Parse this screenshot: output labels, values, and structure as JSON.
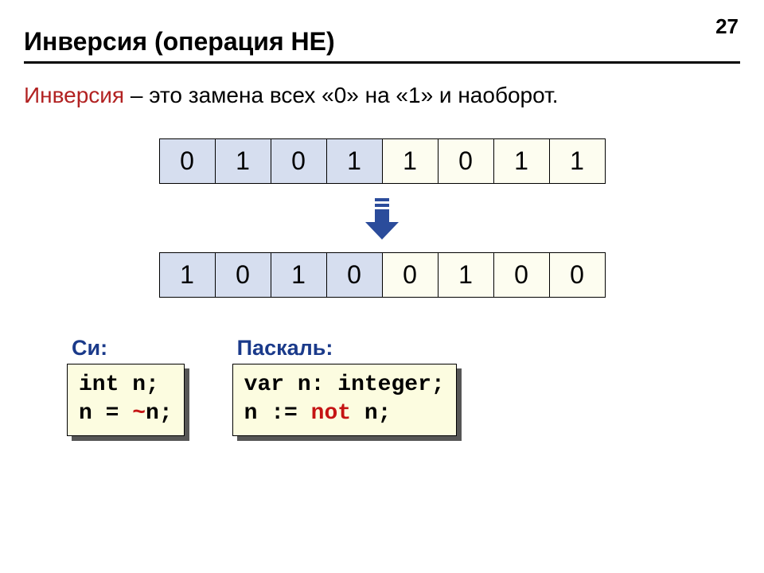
{
  "pageNumber": "27",
  "title": "Инверсия (операция НЕ)",
  "definition": {
    "term": "Инверсия",
    "rest": " – это замена всех «0» на «1» и наоборот."
  },
  "bitsTop": [
    "0",
    "1",
    "0",
    "1",
    "1",
    "0",
    "1",
    "1"
  ],
  "bitsBottom": [
    "1",
    "0",
    "1",
    "0",
    "0",
    "1",
    "0",
    "0"
  ],
  "colorClassesTop": [
    "blue",
    "blue",
    "blue",
    "blue",
    "yellow",
    "yellow",
    "yellow",
    "yellow"
  ],
  "colorClassesBottom": [
    "blue",
    "blue",
    "blue",
    "blue",
    "yellow",
    "yellow",
    "yellow",
    "yellow"
  ],
  "c": {
    "label": "Си:",
    "line1": "int n;",
    "line2a": "n = ",
    "line2op": "~",
    "line2b": "n;"
  },
  "pascal": {
    "label": "Паскаль:",
    "line1": "var n: integer;",
    "line2a": "n := ",
    "line2op": "not",
    "line2b": " n;"
  }
}
